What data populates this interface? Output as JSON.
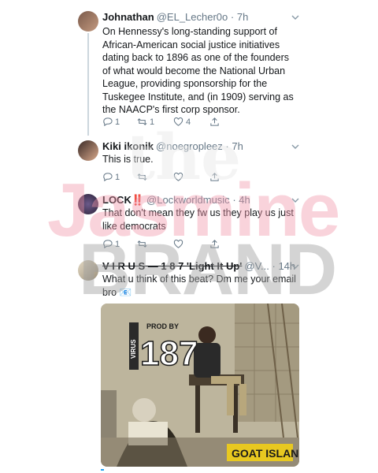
{
  "tweets": [
    {
      "name": "Johnathan",
      "handle": "@EL_Lecher0o",
      "time": "· 7h",
      "text": "On Hennessy's long-standing support of African-American social justice initiatives dating back to 1896 as one of the founders of what would become the National Urban League, providing sponsorship for the Tuskegee Institute, and (in 1909) serving as the NAACP's first corp sponsor.",
      "replies": "1",
      "retweets": "1",
      "likes": "4"
    },
    {
      "name": "Kiki ikonik",
      "handle": "@noegroplеez",
      "time": "· 7h",
      "text": "This is true.",
      "replies": "1",
      "retweets": "",
      "likes": ""
    },
    {
      "name": "LOCK‼️",
      "handle": "@Lockworldmusic",
      "time": "· 4h",
      "text": "That don't mean they fw us they play us just like democrats",
      "replies": "1",
      "retweets": "",
      "likes": ""
    },
    {
      "name": "V I R U S — 1 8 7 'Light It Up'",
      "handle": "@V...",
      "time": "· 14h",
      "text": "What u think of this beat? Dm me your email bro 📧",
      "replies": "",
      "retweets": "",
      "likes": ""
    }
  ],
  "watermark": {
    "line1": "the",
    "line2": "Jasmine",
    "line3": "BRAND"
  },
  "media": {
    "prod_by": "PROD BY",
    "number": "187",
    "side_text": "VIRUS",
    "title": "GOAT ISLAND"
  },
  "icons": [
    "reply-icon",
    "retweet-icon",
    "like-icon",
    "share-icon",
    "chevron-down-icon"
  ]
}
